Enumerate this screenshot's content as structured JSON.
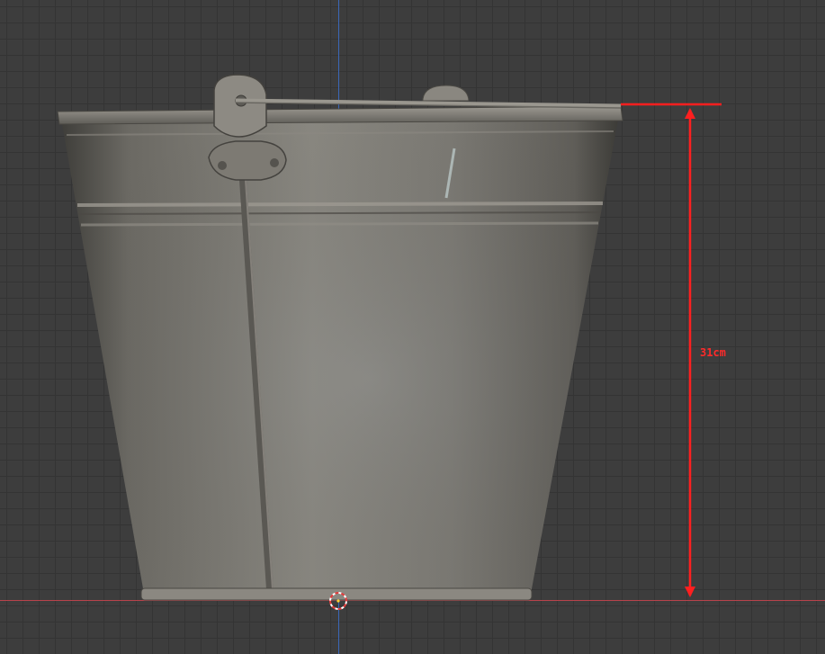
{
  "viewport": {
    "background_color": "#3d3d3d",
    "grid_color": "#343434",
    "axis_x_color": "#b8434b",
    "axis_y_color": "#3b67b8"
  },
  "object": {
    "icon": "bucket-model",
    "material_color": "#7a7770"
  },
  "measurement": {
    "label": "31cm",
    "color": "#ff2a2a"
  },
  "cursor": {
    "icon": "3d-cursor-icon"
  }
}
